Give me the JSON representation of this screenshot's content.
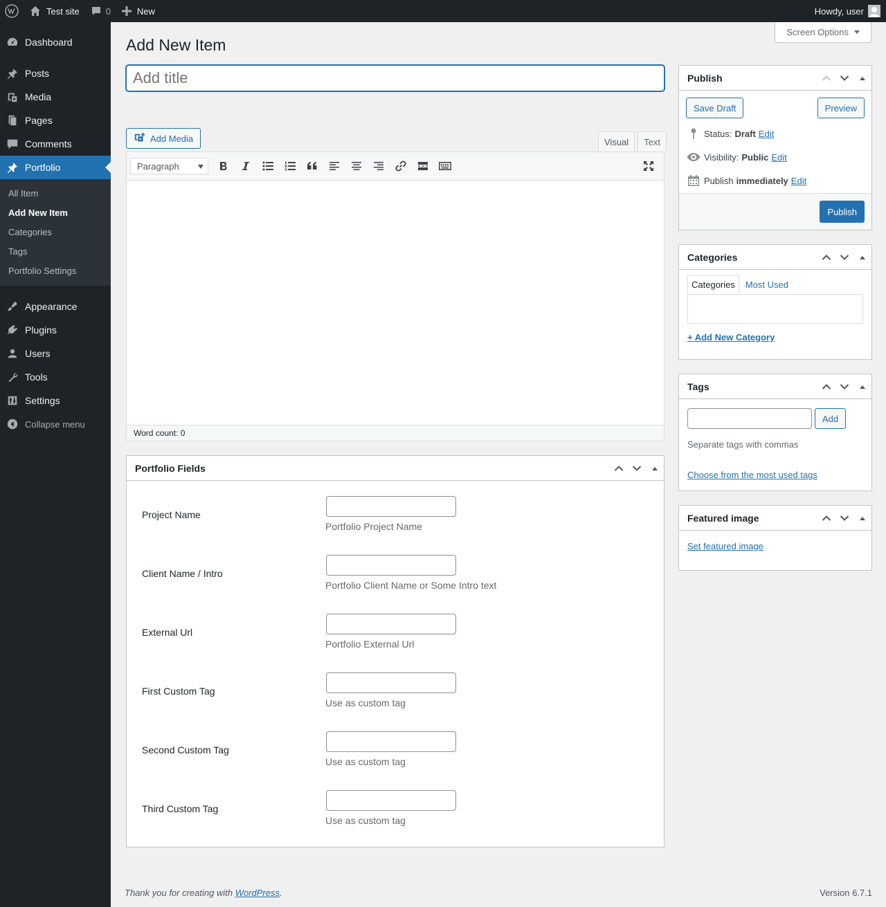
{
  "adminbar": {
    "site_name": "Test site",
    "comments_count": "0",
    "new_label": "New",
    "howdy": "Howdy, user"
  },
  "sidebar": {
    "items": [
      {
        "label": "Dashboard",
        "icon": "dashboard-icon"
      },
      {
        "label": "Posts",
        "icon": "pin-icon"
      },
      {
        "label": "Media",
        "icon": "media-icon"
      },
      {
        "label": "Pages",
        "icon": "pages-icon"
      },
      {
        "label": "Comments",
        "icon": "comment-icon"
      },
      {
        "label": "Portfolio",
        "icon": "pin-icon"
      },
      {
        "label": "Appearance",
        "icon": "brush-icon"
      },
      {
        "label": "Plugins",
        "icon": "plugin-icon"
      },
      {
        "label": "Users",
        "icon": "user-icon"
      },
      {
        "label": "Tools",
        "icon": "wrench-icon"
      },
      {
        "label": "Settings",
        "icon": "settings-icon"
      }
    ],
    "submenu": [
      "All Item",
      "Add New Item",
      "Categories",
      "Tags",
      "Portfolio Settings"
    ],
    "collapse": "Collapse menu"
  },
  "screen_options": "Screen Options",
  "page_title": "Add New Item",
  "title_placeholder": "Add title",
  "editor": {
    "add_media": "Add Media",
    "tab_visual": "Visual",
    "tab_text": "Text",
    "format": "Paragraph",
    "word_count": "Word count: 0"
  },
  "portfolio_fields": {
    "title": "Portfolio Fields",
    "rows": [
      {
        "label": "Project Name",
        "desc": "Portfolio Project Name"
      },
      {
        "label": "Client Name / Intro",
        "desc": "Portfolio Client Name or Some Intro text"
      },
      {
        "label": "External Url",
        "desc": "Portfolio External Url"
      },
      {
        "label": "First Custom Tag",
        "desc": "Use as custom tag"
      },
      {
        "label": "Second Custom Tag",
        "desc": "Use as custom tag"
      },
      {
        "label": "Third Custom Tag",
        "desc": "Use as custom tag"
      }
    ]
  },
  "publish": {
    "title": "Publish",
    "save_draft": "Save Draft",
    "preview": "Preview",
    "status_label": "Status:",
    "status_value": "Draft",
    "visibility_label": "Visibility:",
    "visibility_value": "Public",
    "publish_label": "Publish",
    "publish_value": "immediately",
    "edit": "Edit",
    "publish_button": "Publish"
  },
  "categories": {
    "title": "Categories",
    "tab_all": "Categories",
    "tab_most_used": "Most Used",
    "add_new": "+ Add New Category"
  },
  "tags": {
    "title": "Tags",
    "add": "Add",
    "hint": "Separate tags with commas",
    "choose": "Choose from the most used tags"
  },
  "featured_image": {
    "title": "Featured image",
    "set": "Set featured image"
  },
  "footer": {
    "thanks_prefix": "Thank you for creating with ",
    "wp_link": "WordPress",
    "thanks_suffix": ".",
    "version": "Version 6.7.1"
  },
  "colors": {
    "accent": "#2271b1",
    "adminbar_bg": "#1d2327",
    "background": "#f0f0f1"
  }
}
